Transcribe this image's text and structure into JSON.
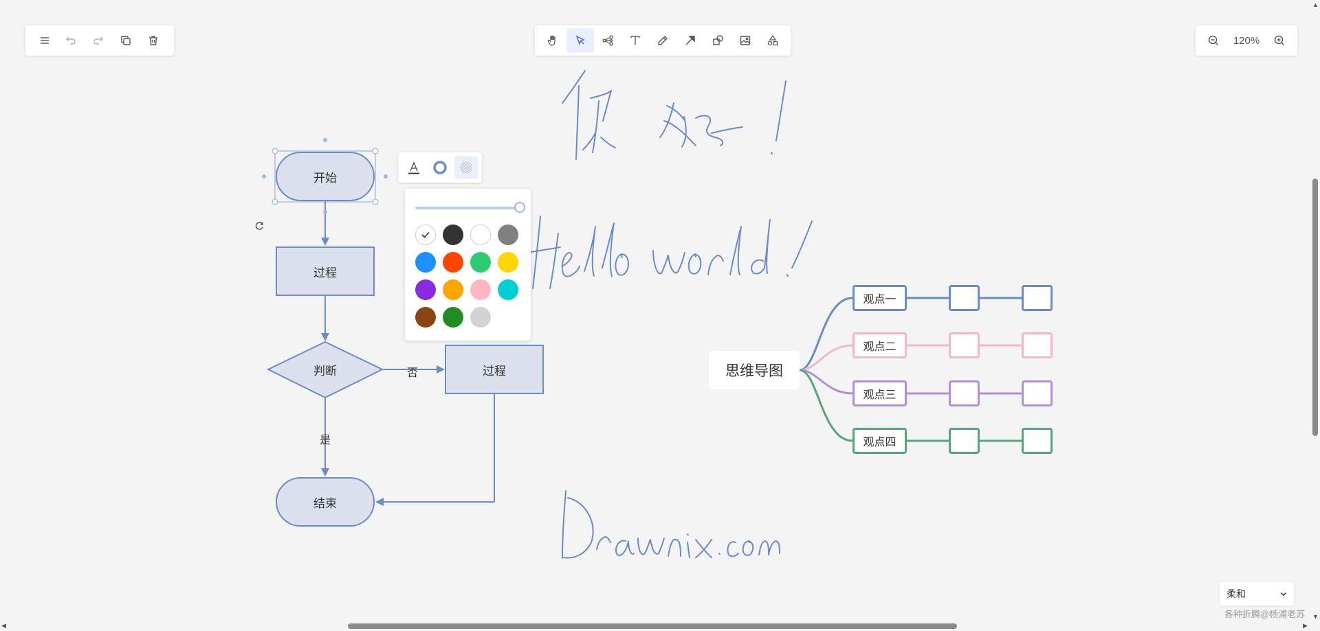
{
  "left_toolbar": {
    "menu": "menu-icon",
    "undo": "undo-icon",
    "redo": "redo-icon",
    "duplicate": "duplicate-icon",
    "delete": "trash-icon"
  },
  "main_toolbar": {
    "tools": [
      "hand-icon",
      "pointer-icon",
      "mindmap-icon",
      "text-icon",
      "pen-icon",
      "arrow-icon",
      "shape-icon",
      "image-icon",
      "extra-tools-icon"
    ],
    "active_tool": "pointer-icon"
  },
  "zoom": {
    "level": "120%"
  },
  "flowchart": {
    "start": "开始",
    "process1": "过程",
    "decision": "判断",
    "process2": "过程",
    "end": "结束",
    "no_label": "否",
    "yes_label": "是"
  },
  "handwriting": {
    "line1": "你 好 !",
    "line2": "Hello world !",
    "line3": "Drawnix.com"
  },
  "mindmap": {
    "root": "思维导图",
    "branches": [
      {
        "label": "观点一",
        "color": "#6b8cc7"
      },
      {
        "label": "观点二",
        "color": "#f2b8c6"
      },
      {
        "label": "观点三",
        "color": "#b28fdc"
      },
      {
        "label": "观点四",
        "color": "#55a77a"
      }
    ]
  },
  "color_panel": {
    "opacity_percent": 100,
    "swatches": [
      "transparent",
      "#333333",
      "#ffffff",
      "#808080",
      "#1e90ff",
      "#ff4500",
      "#2ecc71",
      "#ffd700",
      "#8a2be2",
      "#ffa500",
      "#ffb6c1",
      "#00ced1",
      "#8b4513",
      "#228b22",
      "#d3d3d3"
    ],
    "selected": "transparent"
  },
  "theme_select": {
    "value": "柔和"
  },
  "watermark": "各种折腾@杨浦老苏",
  "colors": {
    "accent": "#6b8cc7",
    "node_fill": "#dde1ee"
  }
}
